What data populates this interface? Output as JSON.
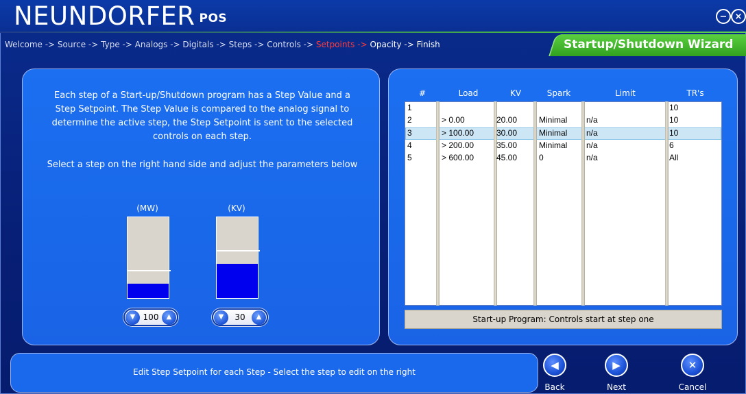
{
  "app": {
    "name": "NEUNDORFER",
    "suffix": "POS"
  },
  "window": {
    "minimize_icon": "minus-circle-icon",
    "close_icon": "close-circle-icon"
  },
  "breadcrumb": {
    "before": "Welcome -> Source -> Type -> Analogs -> Digitals -> Steps -> Controls -> ",
    "active": "Setpoints -> ",
    "after": "Opacity -> Finish"
  },
  "wizard_title": "Startup/Shutdown Wizard",
  "instructions": {
    "line1": "Each step of a Start-up/Shutdown program has a Step Value and a",
    "line2": "Step Setpoint. The Step Value is compared to the analog signal to",
    "line3": "determine the active step, the Step Setpoint is sent to the selected",
    "line4": "controls on each step.",
    "select": "Select a step on the right hand side and adjust the parameters below"
  },
  "gauges": [
    {
      "label": "(MW)",
      "value": "100",
      "fill_fraction": 0.18,
      "marker_fraction": 0.33
    },
    {
      "label": "(KV)",
      "value": "30",
      "fill_fraction": 0.42,
      "marker_fraction": 0.58
    }
  ],
  "table": {
    "headers": [
      "#",
      "Load",
      "KV",
      "Spark",
      "Limit",
      "TR's"
    ],
    "rows": [
      [
        "1",
        "",
        "",
        "",
        "",
        "10"
      ],
      [
        "2",
        "> 0.00",
        "20.00",
        "Minimal",
        "n/a",
        "10"
      ],
      [
        "3",
        "> 100.00",
        "30.00",
        "Minimal",
        "n/a",
        "10"
      ],
      [
        "4",
        "> 200.00",
        "35.00",
        "Minimal",
        "n/a",
        "6"
      ],
      [
        "5",
        "> 600.00",
        "45.00",
        "0",
        "n/a",
        "All"
      ]
    ],
    "selected_row": 2,
    "footer": "Start-up Program: Controls start at step one"
  },
  "status": "Edit Step Setpoint for each Step - Select the step to edit on the right",
  "nav": {
    "back": "Back",
    "next": "Next",
    "cancel": "Cancel"
  }
}
